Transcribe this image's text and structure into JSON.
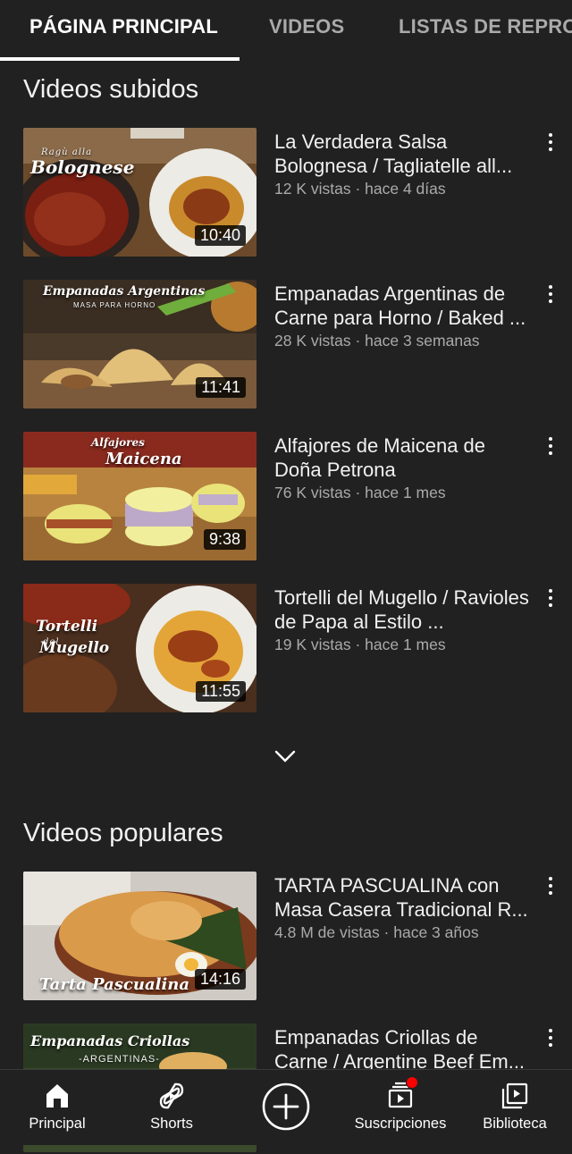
{
  "tabs": [
    {
      "label": "PÁGINA PRINCIPAL"
    },
    {
      "label": "VIDEOS"
    },
    {
      "label": "LISTAS DE REPRODUCCIÓN"
    }
  ],
  "sections": {
    "uploaded": {
      "title": "Videos subidos"
    },
    "popular": {
      "title": "Videos populares"
    }
  },
  "videos": [
    {
      "title": "La Verdadera Salsa Bolognesa / Tagliatelle all...",
      "stats": "12 K vistas · hace 4 días",
      "duration": "10:40",
      "thumb_text": "Ragù alla Bolognese"
    },
    {
      "title": "Empanadas Argentinas de Carne para Horno / Baked ...",
      "stats": "28 K vistas · hace 3 semanas",
      "duration": "11:41",
      "thumb_text": "Empanadas Argentinas",
      "thumb_sub": "MASA PARA HORNO"
    },
    {
      "title": "Alfajores de Maicena de Doña Petrona",
      "stats": "76 K vistas · hace 1 mes",
      "duration": "9:38",
      "thumb_text": "Alfajores de Maicena"
    },
    {
      "title": "Tortelli del Mugello / Ravioles de Papa al Estilo ...",
      "stats": "19 K vistas · hace 1 mes",
      "duration": "11:55",
      "thumb_text": "Tortelli del Mugello"
    },
    {
      "title": "TARTA PASCUALINA con Masa Casera Tradicional R...",
      "stats": "4.8 M de vistas · hace 3 años",
      "duration": "14:16",
      "thumb_text": "Tarta Pascualina"
    },
    {
      "title": "Empanadas Criollas de Carne / Argentine Beef Em...",
      "thumb_text": "Empanadas Criollas",
      "thumb_sub": "-ARGENTINAS-"
    }
  ],
  "bottom_nav": [
    {
      "label": "Principal",
      "icon": "home-icon"
    },
    {
      "label": "Shorts",
      "icon": "shorts-icon"
    },
    {
      "label": "",
      "icon": "create-icon"
    },
    {
      "label": "Suscripciones",
      "icon": "subscriptions-icon"
    },
    {
      "label": "Biblioteca",
      "icon": "library-icon"
    }
  ],
  "colors": {
    "background": "#212121",
    "text_primary": "#f1f1f1",
    "text_secondary": "#aaaaaa",
    "notification": "#ff0000"
  }
}
